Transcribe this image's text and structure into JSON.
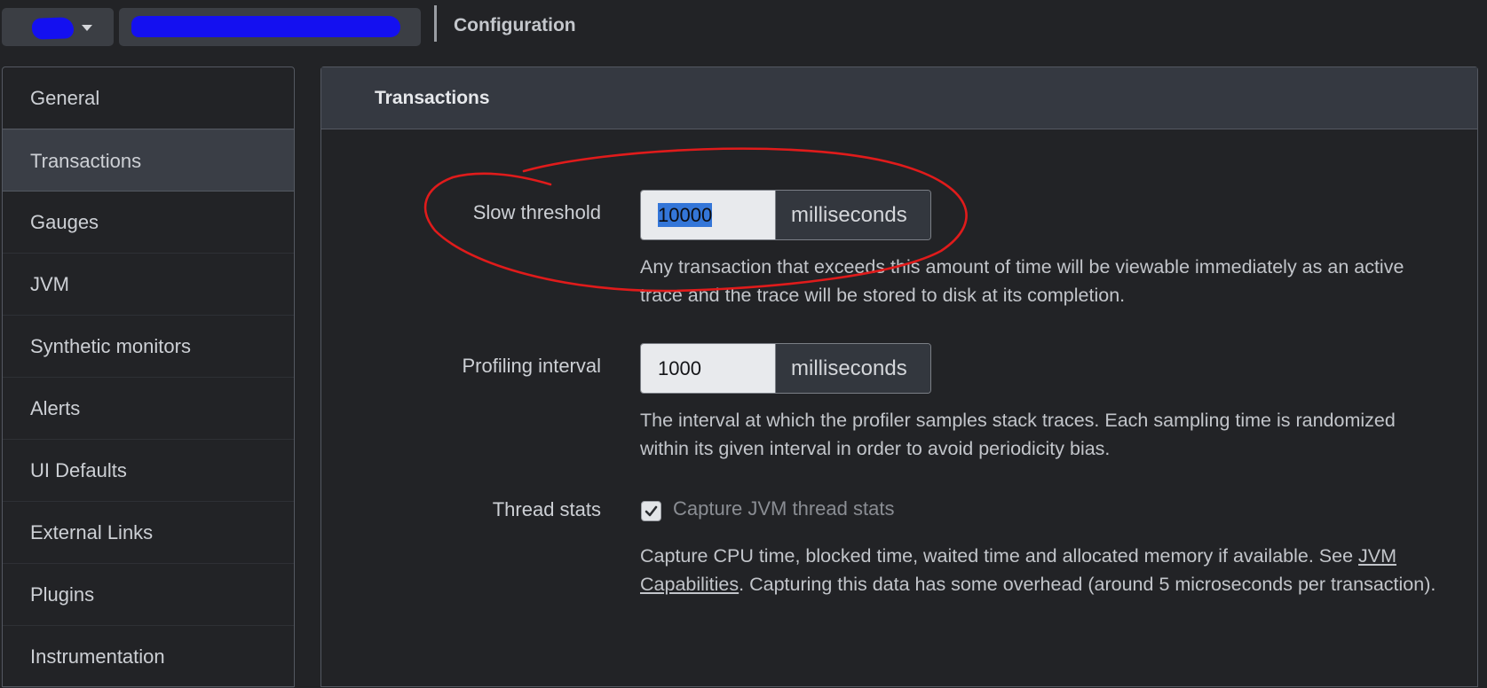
{
  "header": {
    "title": "Configuration"
  },
  "sidebar": {
    "items": [
      {
        "label": "General"
      },
      {
        "label": "Transactions"
      },
      {
        "label": "Gauges"
      },
      {
        "label": "JVM"
      },
      {
        "label": "Synthetic monitors"
      },
      {
        "label": "Alerts"
      },
      {
        "label": "UI Defaults"
      },
      {
        "label": "External Links"
      },
      {
        "label": "Plugins"
      },
      {
        "label": "Instrumentation"
      }
    ],
    "active_index": 1
  },
  "panel": {
    "title": "Transactions",
    "slow_threshold": {
      "label": "Slow threshold",
      "value": "10000",
      "unit": "milliseconds",
      "help": "Any transaction that exceeds this amount of time will be viewable immediately as an active trace and the trace will be stored to disk at its completion."
    },
    "profiling_interval": {
      "label": "Profiling interval",
      "value": "1000",
      "unit": "milliseconds",
      "help": "The interval at which the profiler samples stack traces. Each sampling time is randomized within its given interval in order to avoid periodicity bias."
    },
    "thread_stats": {
      "label": "Thread stats",
      "checkbox_label": "Capture JVM thread stats",
      "checked": true,
      "help_prefix": "Capture CPU time, blocked time, waited time and allocated memory if available. See ",
      "help_link": "JVM Capabilities",
      "help_suffix": ". Capturing this data has some overhead (around 5 microseconds per transaction)."
    }
  },
  "colors": {
    "annotation_circle": "#e01b1b",
    "redaction": "#1410f0",
    "selection": "#3476d8"
  }
}
